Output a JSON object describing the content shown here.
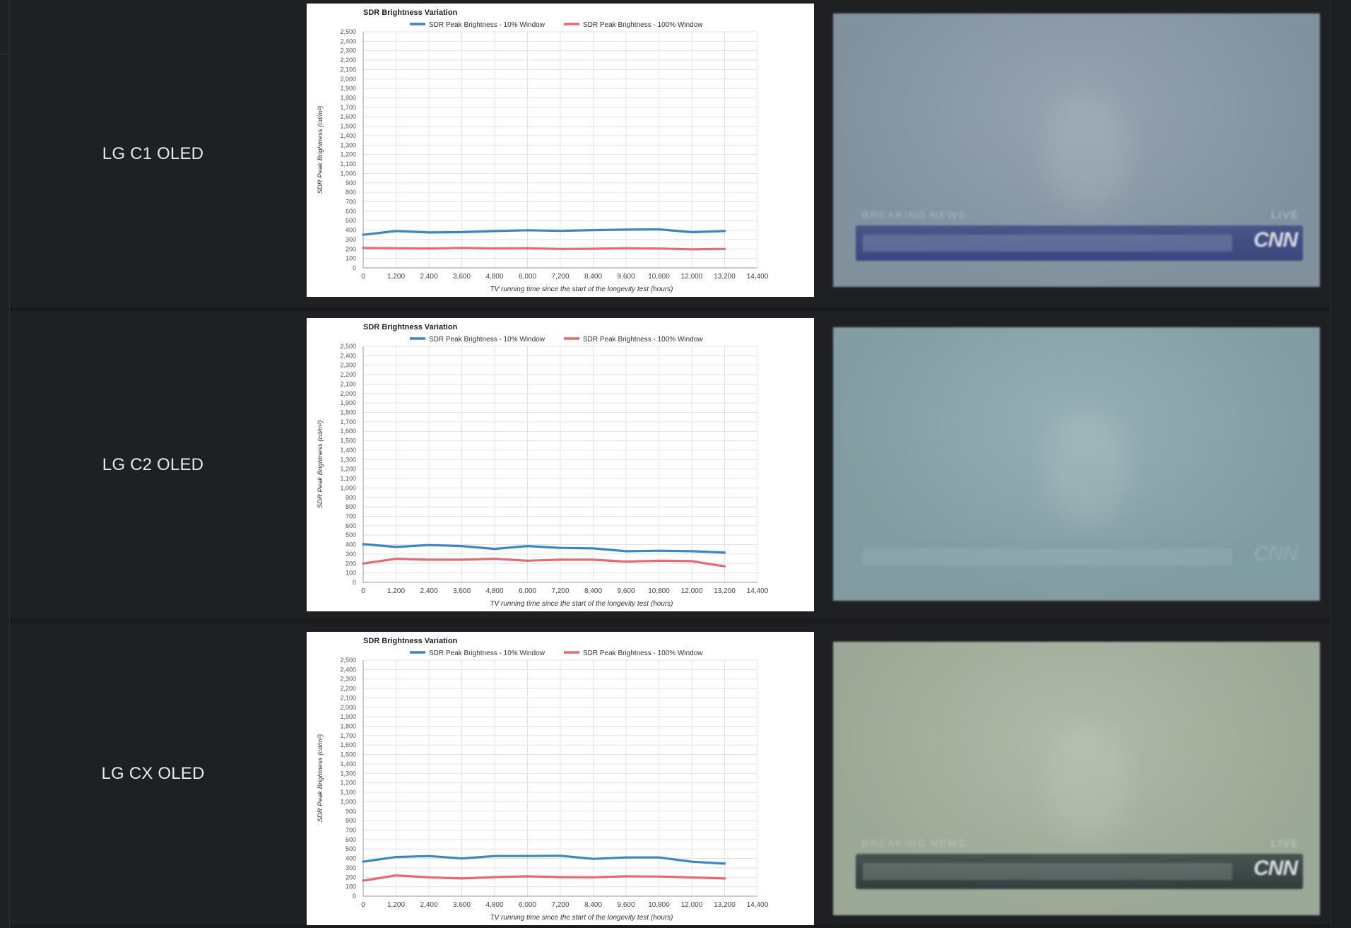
{
  "rows": [
    {
      "model": "LG C1 OLED",
      "photo": {
        "banner": "BREAKING NEWS",
        "live": "LIVE",
        "logo": "CNN",
        "tint": "#8a9aa8",
        "ticker": "#2e3a7a"
      },
      "chart_data": {
        "type": "line",
        "title": "SDR Brightness Variation",
        "xlabel": "TV running time since the start of the longevity test (hours)",
        "ylabel": "SDR Peak Brightness (cd/m²)",
        "xlim": [
          0,
          14400
        ],
        "ylim": [
          0,
          2500
        ],
        "x": [
          0,
          1200,
          2400,
          3600,
          4800,
          6000,
          7200,
          8400,
          9600,
          10800,
          12000,
          13200
        ],
        "series": [
          {
            "name": "SDR Peak Brightness - 10% Window",
            "color": "#3b87c4",
            "values": [
              350,
              390,
              375,
              378,
              390,
              398,
              392,
              400,
              405,
              408,
              378,
              390
            ]
          },
          {
            "name": "SDR Peak Brightness - 100% Window",
            "color": "#e66a72",
            "values": [
              210,
              208,
              205,
              212,
              206,
              208,
              200,
              202,
              208,
              204,
              196,
              200
            ]
          }
        ],
        "grid": true,
        "legend": "top"
      }
    },
    {
      "model": "LG C2 OLED",
      "photo": {
        "banner": "",
        "live": "",
        "logo": "CNN",
        "tint": "#8aa6ac",
        "ticker": "#7e9ea3"
      },
      "chart_data": {
        "type": "line",
        "title": "SDR Brightness Variation",
        "xlabel": "TV running time since the start of the longevity test (hours)",
        "ylabel": "SDR Peak Brightness (cd/m²)",
        "xlim": [
          0,
          14400
        ],
        "ylim": [
          0,
          2500
        ],
        "x": [
          0,
          1200,
          2400,
          3600,
          4800,
          6000,
          7200,
          8400,
          9600,
          10800,
          12000,
          13200
        ],
        "series": [
          {
            "name": "SDR Peak Brightness - 10% Window",
            "color": "#3b87c4",
            "values": [
              405,
              375,
              395,
              385,
              355,
              385,
              365,
              360,
              330,
              335,
              330,
              315
            ]
          },
          {
            "name": "SDR Peak Brightness - 100% Window",
            "color": "#e66a72",
            "values": [
              200,
              250,
              240,
              240,
              250,
              230,
              240,
              240,
              220,
              230,
              225,
              170
            ]
          }
        ],
        "grid": true,
        "legend": "top"
      }
    },
    {
      "model": "LG CX OLED",
      "photo": {
        "banner": "BREAKING NEWS",
        "live": "LIVE",
        "logo": "CNN",
        "tint": "#a6b2a0",
        "ticker": "#1f2c2e"
      },
      "chart_data": {
        "type": "line",
        "title": "SDR Brightness Variation",
        "xlabel": "TV running time since the start of the longevity test (hours)",
        "ylabel": "SDR Peak Brightness (cd/m²)",
        "xlim": [
          0,
          14400
        ],
        "ylim": [
          0,
          2500
        ],
        "x": [
          0,
          1200,
          2400,
          3600,
          4800,
          6000,
          7200,
          8400,
          9600,
          10800,
          12000,
          13200
        ],
        "series": [
          {
            "name": "SDR Peak Brightness - 10% Window",
            "color": "#3b87c4",
            "values": [
              365,
              415,
              425,
              400,
              425,
              425,
              428,
              395,
              410,
              410,
              365,
              345
            ]
          },
          {
            "name": "SDR Peak Brightness - 100% Window",
            "color": "#e66a72",
            "values": [
              165,
              220,
              200,
              188,
              202,
              210,
              202,
              200,
              210,
              208,
              198,
              188
            ]
          }
        ],
        "grid": true,
        "legend": "top"
      }
    }
  ]
}
